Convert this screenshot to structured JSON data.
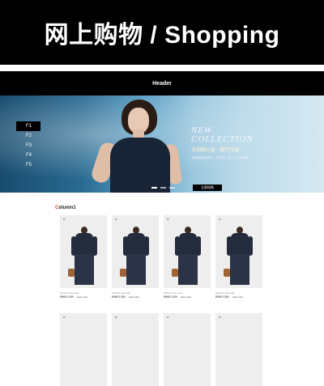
{
  "banner": {
    "title": "网上购物 / Shopping"
  },
  "header": {
    "title": "Header"
  },
  "hero": {
    "nav": [
      "F1",
      "F2",
      "F3",
      "F4",
      "F5"
    ],
    "headline_1": "NEW",
    "headline_2": "COLLECTION",
    "tagline": "衣相随心香 · 撒欢性装",
    "description": "全情展现自我魅力，展现独一无二的时尚风格",
    "button_label": "立即抢购"
  },
  "section": {
    "first_letter": "C",
    "rest": "olumn1"
  },
  "products": [
    {
      "name": "Product one style",
      "price": "RMB 1299",
      "more": "view more"
    },
    {
      "name": "Product one style",
      "price": "RMB 1299",
      "more": "view more"
    },
    {
      "name": "Product one style",
      "price": "RMB 1299",
      "more": "view more"
    },
    {
      "name": "Product one style",
      "price": "RMB 1299",
      "more": "view more"
    }
  ],
  "colors": {
    "header_bg": "#000000",
    "accent": "#d43a2a",
    "hero_blue": "#2a6a91"
  }
}
